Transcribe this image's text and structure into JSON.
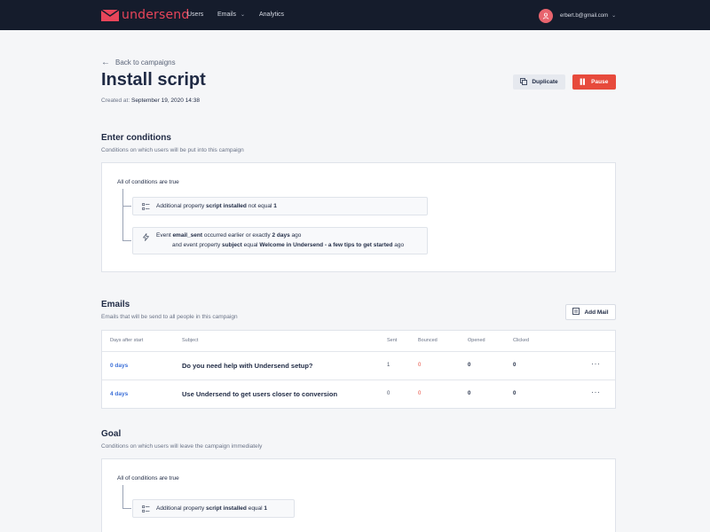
{
  "topbar": {
    "brand": "undersend",
    "nav": [
      {
        "label": "Users"
      },
      {
        "label": "Emails",
        "dropdown": true
      },
      {
        "label": "Analytics"
      }
    ],
    "user_email": "erbert.b@gmail.com"
  },
  "header": {
    "back_label": "Back to campaigns",
    "title": "Install script",
    "created_label": "Created at:",
    "created_value": "September 19, 2020 14:38",
    "duplicate_label": "Duplicate",
    "pause_label": "Pause"
  },
  "enter_conditions": {
    "title": "Enter conditions",
    "subtitle": "Conditions on which users will be put into this campaign",
    "match_label": "All of conditions are true",
    "conditions": [
      {
        "icon": "property-icon",
        "prefix": "Additional property",
        "property": "script installed",
        "operator": "not equal",
        "value": "1"
      },
      {
        "icon": "event-icon",
        "line1_prefix": "Event",
        "event": "email_sent",
        "line1_operator": "occurred earlier or exactly",
        "line1_value": "2 days",
        "line1_suffix": "ago",
        "line2_prefix": "and event property",
        "line2_property": "subject",
        "line2_operator": "equal",
        "line2_value": "Welcome in Undersend - a few tips to get started",
        "line2_suffix": "ago"
      }
    ]
  },
  "emails": {
    "title": "Emails",
    "subtitle": "Emails that will be send to all people in this campaign",
    "add_label": "Add Mail",
    "columns": [
      "Days after start",
      "Subject",
      "Sent",
      "Bounced",
      "Opened",
      "Clicked"
    ],
    "rows": [
      {
        "days": "0 days",
        "subject": "Do you need help with Undersend setup?",
        "sent": "1",
        "bounced": "0",
        "opened": "0",
        "clicked": "0"
      },
      {
        "days": "4 days",
        "subject": "Use Undersend to get users closer to conversion",
        "sent": "0",
        "bounced": "0",
        "opened": "0",
        "clicked": "0"
      }
    ],
    "menu_glyph": "···"
  },
  "goal": {
    "title": "Goal",
    "subtitle": "Conditions on which users will leave the campaign immediately",
    "match_label": "All of conditions are true",
    "conditions": [
      {
        "icon": "property-icon",
        "prefix": "Additional property",
        "property": "script installed",
        "operator": "equal",
        "value": "1"
      }
    ]
  },
  "colors": {
    "topbar_bg": "#151c2c",
    "brand": "#e8455a",
    "accent_link": "#3b6fd8",
    "danger": "#e74a3c",
    "page_bg": "#f5f6f8"
  }
}
